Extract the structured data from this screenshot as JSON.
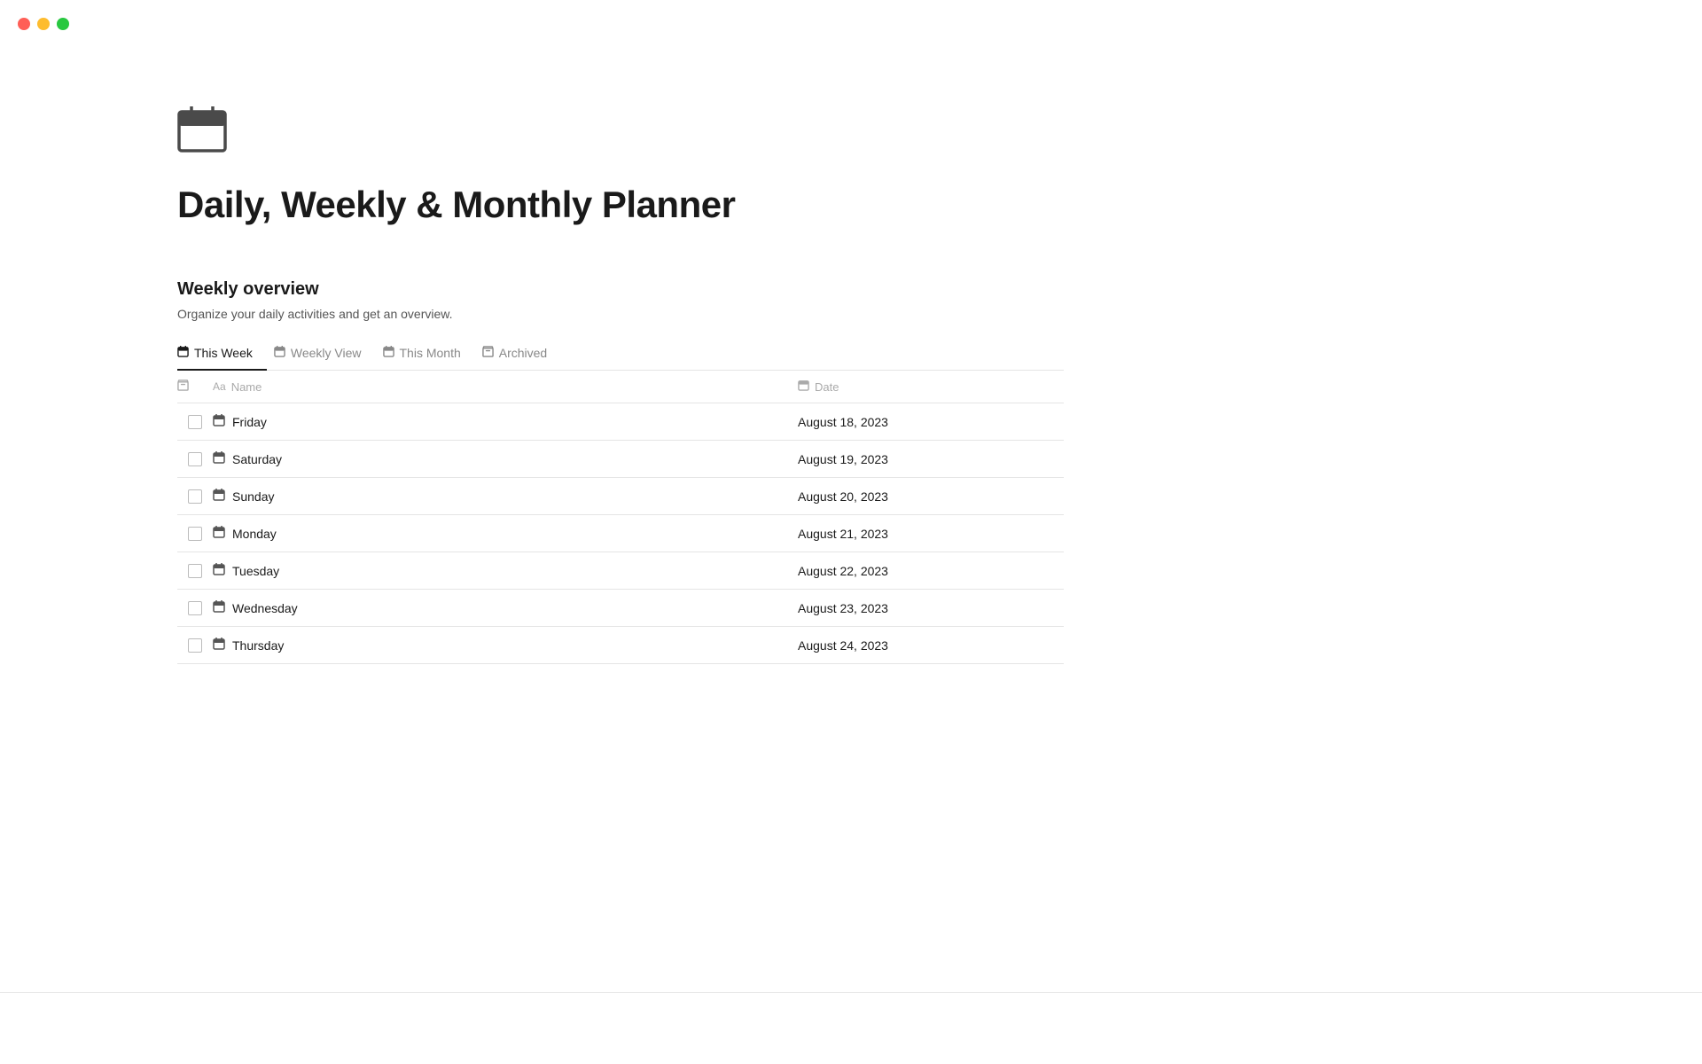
{
  "window": {
    "traffic_lights": {
      "red": "red",
      "yellow": "yellow",
      "green": "green"
    }
  },
  "page": {
    "icon_label": "calendar-icon",
    "title": "Daily, Weekly & Monthly Planner",
    "section": {
      "title": "Weekly overview",
      "description": "Organize your daily activities and get an overview."
    },
    "tabs": [
      {
        "id": "this-week",
        "label": "This Week",
        "icon": "📅",
        "active": true
      },
      {
        "id": "weekly-view",
        "label": "Weekly View",
        "icon": "📅",
        "active": false
      },
      {
        "id": "this-month",
        "label": "This Month",
        "icon": "📅",
        "active": false
      },
      {
        "id": "archived",
        "label": "Archived",
        "icon": "🗑",
        "active": false
      }
    ],
    "table": {
      "columns": [
        {
          "id": "trash",
          "label": ""
        },
        {
          "id": "name",
          "label": "Name",
          "icon": "Aa"
        },
        {
          "id": "date",
          "label": "Date",
          "icon": "📅"
        }
      ],
      "rows": [
        {
          "name": "Friday",
          "date": "August 18, 2023"
        },
        {
          "name": "Saturday",
          "date": "August 19, 2023"
        },
        {
          "name": "Sunday",
          "date": "August 20, 2023"
        },
        {
          "name": "Monday",
          "date": "August 21, 2023"
        },
        {
          "name": "Tuesday",
          "date": "August 22, 2023"
        },
        {
          "name": "Wednesday",
          "date": "August 23, 2023"
        },
        {
          "name": "Thursday",
          "date": "August 24, 2023"
        }
      ]
    }
  }
}
